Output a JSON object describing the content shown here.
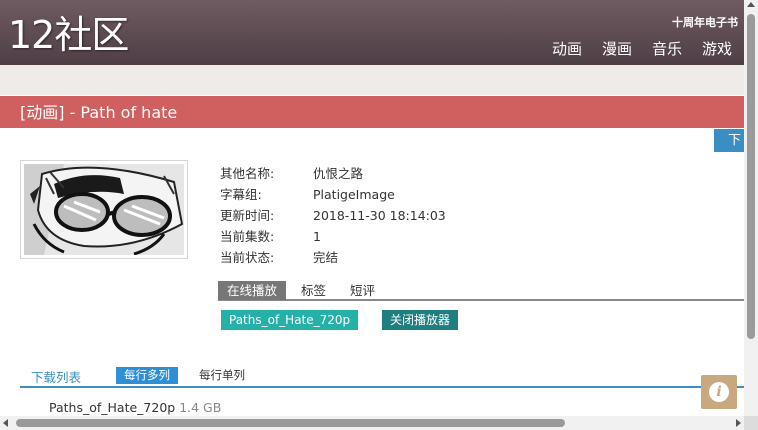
{
  "header": {
    "logo": "12社区",
    "ebook_link": "十周年电子书",
    "nav": [
      "动画",
      "漫画",
      "音乐",
      "游戏"
    ]
  },
  "title": "[动画] - Path of hate",
  "download_tab": "下",
  "info": {
    "rows": [
      {
        "label": "其他名称:",
        "value": "仇恨之路"
      },
      {
        "label": "字幕组:",
        "value": "PlatigeImage"
      },
      {
        "label": "更新时间:",
        "value": "2018-11-30 18:14:03"
      },
      {
        "label": "当前集数:",
        "value": "1"
      },
      {
        "label": "当前状态:",
        "value": "完结"
      }
    ]
  },
  "tabs": [
    "在线播放",
    "标签",
    "短评"
  ],
  "player": {
    "play_label": "Paths_of_Hate_720p",
    "close_label": "关闭播放器"
  },
  "downloads": {
    "label": "下载列表",
    "multi_label": "每行多列",
    "single_label": "每行单列",
    "files": [
      {
        "name": "Paths_of_Hate_720p",
        "size": "1.4 GB"
      }
    ]
  },
  "info_fab": "i",
  "colors": {
    "header": "#5e4b52",
    "title_bar": "#d05f5f",
    "accent_blue": "#3a8ec2",
    "play_button": "#25b1a7",
    "close_button": "#1f7f80",
    "info_fab": "#c8a87f"
  },
  "icons": {
    "info_fab": "info-icon"
  }
}
